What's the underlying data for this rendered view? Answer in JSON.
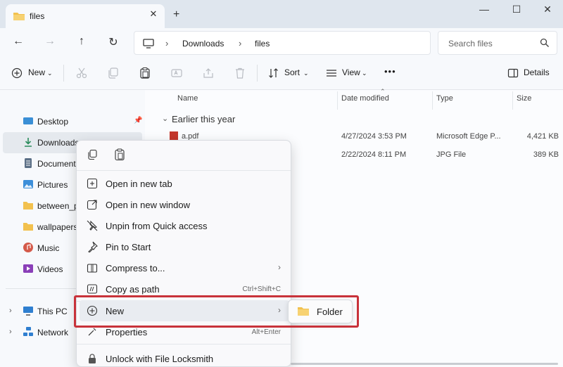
{
  "window": {
    "tab_title": "files",
    "new_tab": "+",
    "close_tab": "✕",
    "minimize": "—",
    "maximize": "☐",
    "close": "✕"
  },
  "navigation": {
    "back": "←",
    "forward": "→",
    "up": "↑",
    "refresh": "↻",
    "breadcrumbs": [
      "Downloads",
      "files"
    ],
    "search_placeholder": "Search files"
  },
  "toolbar": {
    "new_label": "New",
    "sort_label": "Sort",
    "view_label": "View",
    "more": "•••",
    "details_label": "Details"
  },
  "sidebar": {
    "items": [
      {
        "label": "Desktop",
        "icon": "desktop-icon"
      },
      {
        "label": "Downloads",
        "icon": "download-icon"
      },
      {
        "label": "Documents",
        "icon": "documents-icon"
      },
      {
        "label": "Pictures",
        "icon": "pictures-icon"
      },
      {
        "label": "between_pc",
        "icon": "folder-icon"
      },
      {
        "label": "wallpapers",
        "icon": "folder-icon"
      },
      {
        "label": "Music",
        "icon": "music-icon"
      },
      {
        "label": "Videos",
        "icon": "videos-icon"
      },
      {
        "label": "This PC",
        "icon": "pc-icon"
      },
      {
        "label": "Network",
        "icon": "network-icon"
      }
    ]
  },
  "file_list": {
    "columns": [
      "Name",
      "Date modified",
      "Type",
      "Size"
    ],
    "group_label": "Earlier this year",
    "rows": [
      {
        "name": "a.pdf",
        "date": "4/27/2024 3:53 PM",
        "type": "Microsoft Edge P...",
        "size": "4,421 KB"
      },
      {
        "name": "",
        "date": "2/22/2024 8:11 PM",
        "type": "JPG File",
        "size": "389 KB"
      }
    ]
  },
  "context_menu": {
    "items": [
      {
        "label": "Open in new tab",
        "icon": "open-tab-icon"
      },
      {
        "label": "Open in new window",
        "icon": "open-window-icon"
      },
      {
        "label": "Unpin from Quick access",
        "icon": "unpin-icon"
      },
      {
        "label": "Pin to Start",
        "icon": "pin-icon"
      },
      {
        "label": "Compress to...",
        "icon": "compress-icon"
      },
      {
        "label": "Copy as path",
        "icon": "copy-path-icon",
        "shortcut": "Ctrl+Shift+C"
      },
      {
        "label": "New",
        "icon": "new-icon"
      },
      {
        "label": "Properties",
        "icon": "properties-icon",
        "shortcut": "Alt+Enter"
      },
      {
        "label": "Unlock with File Locksmith",
        "icon": "lock-icon"
      }
    ],
    "submenu_item": "Folder"
  },
  "colors": {
    "highlight_border": "#c8323a",
    "folder_yellow": "#f2c14e",
    "accent_blue": "#2f6fd1"
  }
}
